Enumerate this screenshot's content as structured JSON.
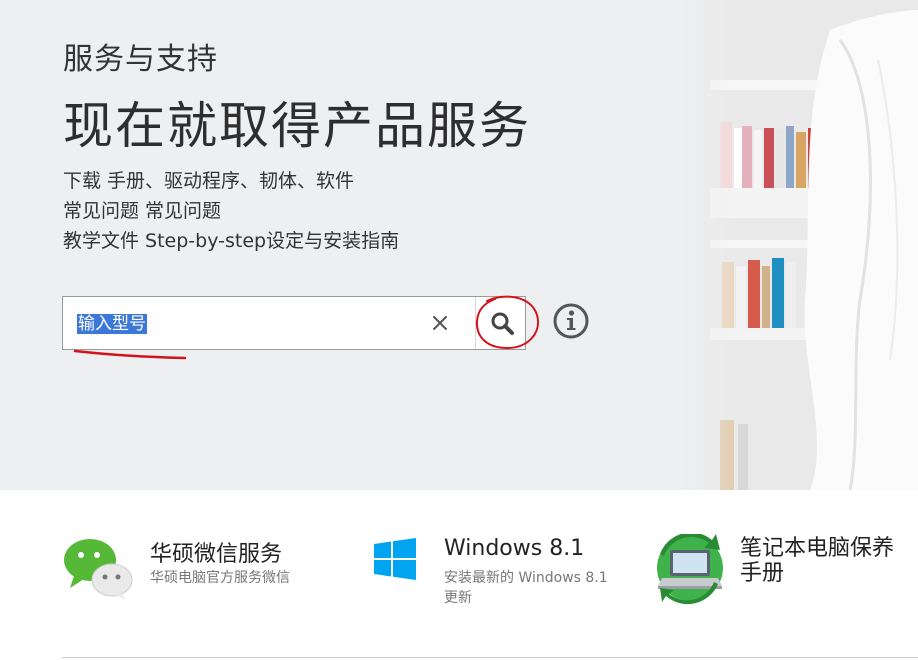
{
  "hero": {
    "eyebrow": "服务与支持",
    "headline": "现在就取得产品服务",
    "links": [
      "下载 手册、驱动程序、韧体、软件",
      "常见问题 常见问题",
      "教学文件 Step-by-step设定与安装指南"
    ]
  },
  "search": {
    "input_value": "输入型号",
    "clear_glyph": "×",
    "annotation_color": "#d1141b"
  },
  "services": [
    {
      "title": "华硕微信服务",
      "desc": "华硕电脑官方服务微信"
    },
    {
      "title": "Windows 8.1",
      "desc": "安装最新的 Windows 8.1 更新"
    },
    {
      "title": "笔记本电脑保养手册",
      "desc": ""
    }
  ],
  "colors": {
    "hero_bg": "#eeeff1",
    "selection": "#3c78d8",
    "wechat_green": "#55b837",
    "windows_blue": "#00a4ef",
    "laptop_green": "#3fb24b"
  }
}
